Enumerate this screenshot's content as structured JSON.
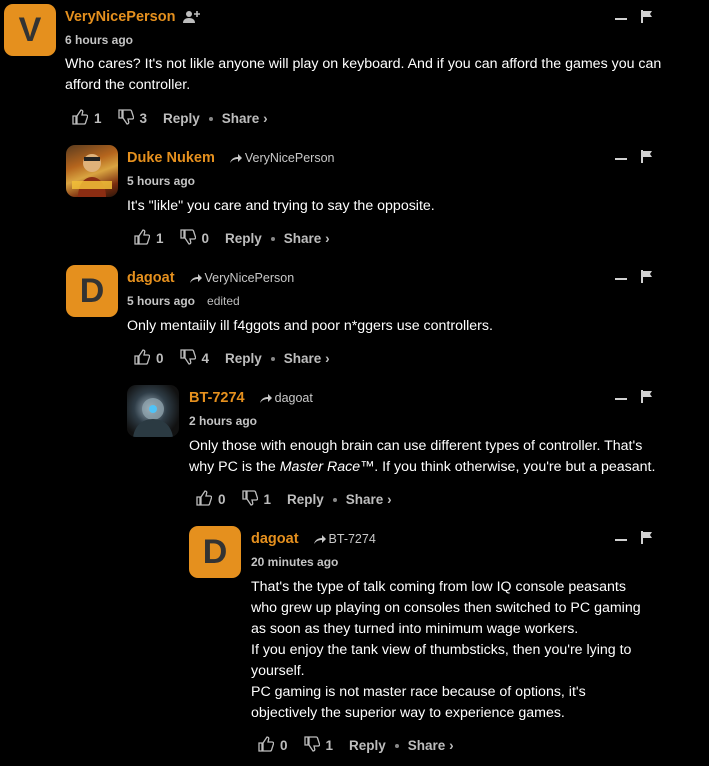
{
  "comments": [
    {
      "username": "VeryNicePerson",
      "avatar_letter": "V",
      "time": "6 hours ago",
      "body": [
        "Who cares? It's not likle anyone will play on keyboard. And if you can afford the games you can afford the controller."
      ],
      "likes": "1",
      "dislikes": "3",
      "reply_label": "Reply",
      "share_label": "Share ›"
    },
    {
      "username": "Duke Nukem",
      "reply_to": "VeryNicePerson",
      "time": "5 hours ago",
      "body": [
        "It's \"likle\" you care and trying to say the opposite."
      ],
      "likes": "1",
      "dislikes": "0",
      "reply_label": "Reply",
      "share_label": "Share ›"
    },
    {
      "username": "dagoat",
      "avatar_letter": "D",
      "reply_to": "VeryNicePerson",
      "time": "5 hours ago",
      "edited": "edited",
      "body": [
        "Only mentaiily ill f4ggots and poor n*ggers use controllers."
      ],
      "likes": "0",
      "dislikes": "4",
      "reply_label": "Reply",
      "share_label": "Share ›"
    },
    {
      "username": "BT-7274",
      "reply_to": "dagoat",
      "time": "2 hours ago",
      "body_line1": "Only those with enough brain can use different types of controller. That's",
      "body_line2_a": "why PC is the ",
      "body_line2_em": "Master Race",
      "body_line2_b": "™. If you think otherwise, you're but a peasant.",
      "likes": "0",
      "dislikes": "1",
      "reply_label": "Reply",
      "share_label": "Share ›"
    },
    {
      "username": "dagoat",
      "avatar_letter": "D",
      "reply_to": "BT-7274",
      "time": "20 minutes ago",
      "body": [
        "That's the type of talk coming from low IQ console peasants",
        "who grew up playing on consoles then switched to PC gaming",
        "as soon as they turned into minimum wage workers.",
        "If you enjoy the tank view of thumbsticks, then you're lying to",
        "yourself.",
        "PC gaming is not master race because of options, it's",
        "objectively the superior way to experience games."
      ],
      "likes": "0",
      "dislikes": "1",
      "reply_label": "Reply",
      "share_label": "Share ›"
    }
  ]
}
